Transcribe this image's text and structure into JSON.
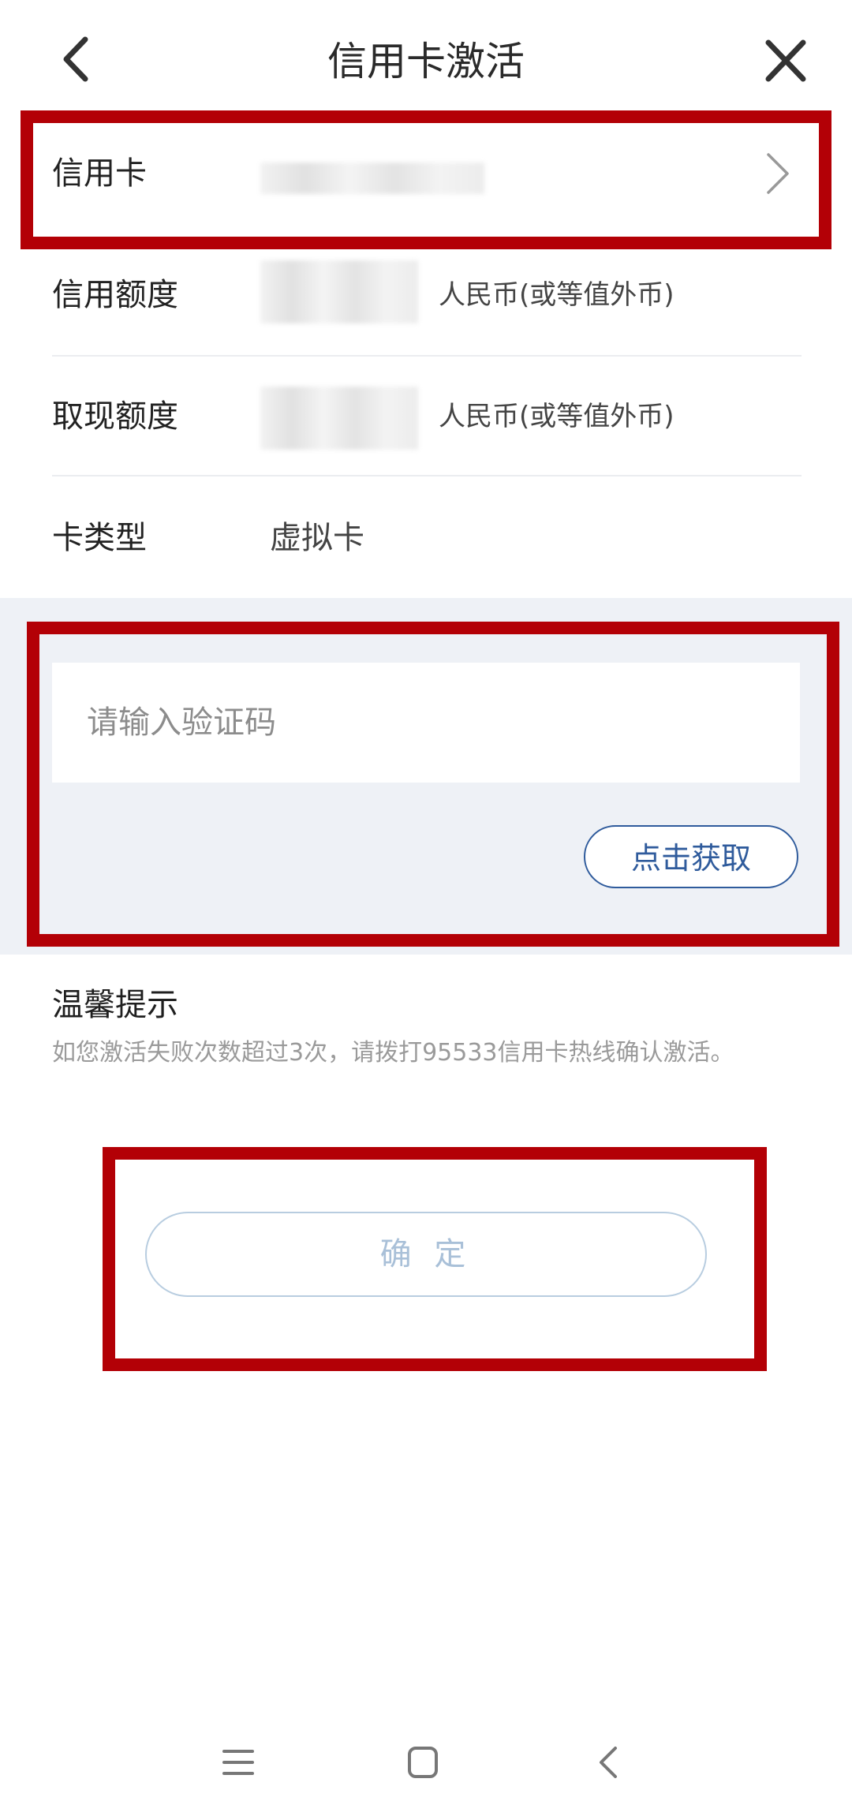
{
  "header": {
    "title": "信用卡激活",
    "back_icon": "chevron-left-icon",
    "close_icon": "close-icon"
  },
  "card_row": {
    "label": "信用卡",
    "value_masked": true,
    "chevron_icon": "chevron-right-icon"
  },
  "credit_limit_row": {
    "label": "信用额度",
    "unit": "人民币(或等值外币)"
  },
  "cash_limit_row": {
    "label": "取现额度",
    "unit": "人民币(或等值外币)"
  },
  "card_type_row": {
    "label": "卡类型",
    "value": "虚拟卡"
  },
  "verification": {
    "placeholder": "请输入验证码",
    "get_code_label": "点击获取"
  },
  "tips": {
    "title": "温馨提示",
    "text": "如您激活失败次数超过3次，请拨打95533信用卡热线确认激活。"
  },
  "confirm_label": "确 定",
  "bottom_nav": {
    "icons": [
      "menu-icon",
      "home-icon",
      "back-icon"
    ]
  },
  "colors": {
    "accent": "#2f5b9c",
    "annotation": "#b30006",
    "section_bg": "#eef1f6",
    "confirm_disabled": "#a9c0d8"
  }
}
